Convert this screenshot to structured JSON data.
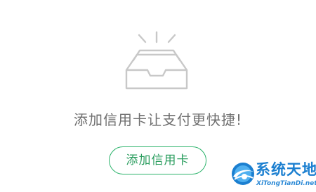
{
  "empty_state": {
    "icon": "empty-tray-icon",
    "message": "添加信用卡让支付更快捷!",
    "button_label": "添加信用卡"
  },
  "watermark": {
    "title": "系统天地",
    "url": "XiTongTianDi.net",
    "icon": "globe-logo-icon"
  },
  "colors": {
    "accent": "#2bb36b",
    "message_text": "#6f6f6f",
    "icon_stroke": "#c8c8c8",
    "watermark_blue": "#1b7fd0"
  }
}
